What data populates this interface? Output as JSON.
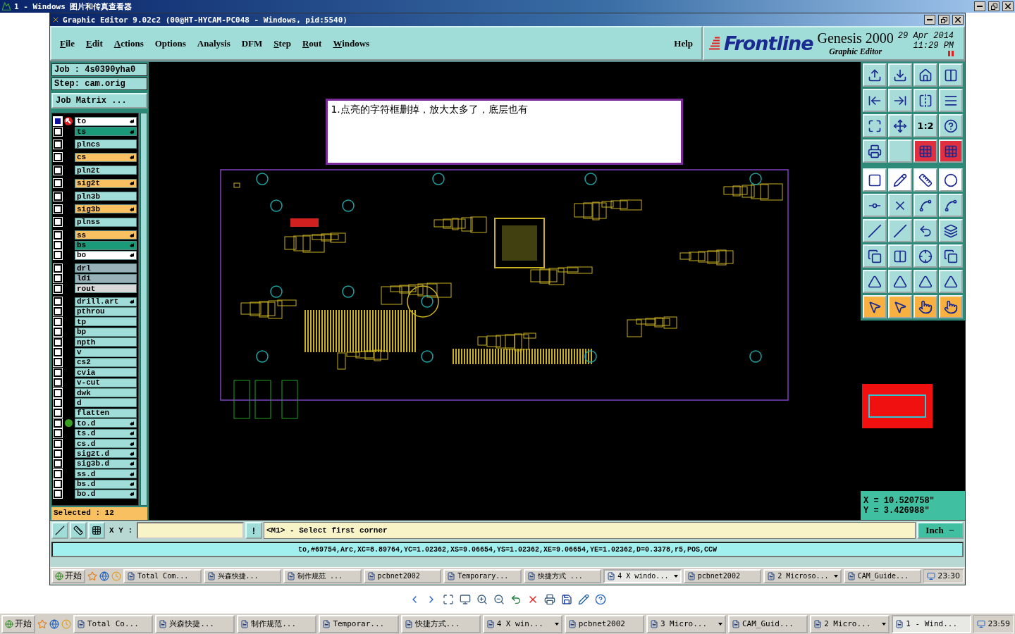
{
  "viewer_window": {
    "title": "1 - Windows 图片和传真查看器"
  },
  "editor_window": {
    "title": "Graphic Editor 9.02c2 (00@HT-HYCAM-PC048 - Windows, pid:5540)"
  },
  "menu": [
    {
      "label": "File",
      "mnemonic": true
    },
    {
      "label": "Edit",
      "mnemonic": true
    },
    {
      "label": "Actions",
      "mnemonic": true
    },
    {
      "label": "Options",
      "mnemonic": false
    },
    {
      "label": "Analysis",
      "mnemonic": false
    },
    {
      "label": "DFM",
      "mnemonic": false
    },
    {
      "label": "Step",
      "mnemonic": true
    },
    {
      "label": "Rout",
      "mnemonic": true
    },
    {
      "label": "Windows",
      "mnemonic": true
    }
  ],
  "help_menu": "Help",
  "brand": {
    "logo": "Frontline",
    "product": "Genesis 2000",
    "subtitle": "Graphic Editor",
    "date": "29 Apr 2014",
    "time": "11:29 PM"
  },
  "job": {
    "job": "Job : 4s0390yha0",
    "step": "Step: cam.orig",
    "matrix_button": "Job Matrix ..."
  },
  "layer_groups": [
    [
      {
        "name": "to",
        "color": "#ffffff",
        "affected": true,
        "work": true,
        "dot": false
      },
      {
        "name": "ts",
        "color": "#1a9a78",
        "affected": true,
        "work": false,
        "dot": false
      }
    ],
    [
      {
        "name": "plncs",
        "color": "#a0dcd8",
        "affected": false,
        "work": false,
        "dot": false
      }
    ],
    [
      {
        "name": "cs",
        "color": "#f8c060",
        "affected": true,
        "work": false,
        "dot": false
      }
    ],
    [
      {
        "name": "pln2t",
        "color": "#a0dcd8",
        "affected": false,
        "work": false,
        "dot": false
      }
    ],
    [
      {
        "name": "sig2t",
        "color": "#f8c060",
        "affected": true,
        "work": false,
        "dot": false
      }
    ],
    [
      {
        "name": "pln3b",
        "color": "#a0dcd8",
        "affected": false,
        "work": false,
        "dot": false
      }
    ],
    [
      {
        "name": "sig3b",
        "color": "#f8c060",
        "affected": true,
        "work": false,
        "dot": false
      }
    ],
    [
      {
        "name": "plnss",
        "color": "#a0dcd8",
        "affected": false,
        "work": false,
        "dot": false
      }
    ],
    [
      {
        "name": "ss",
        "color": "#f8c060",
        "affected": true,
        "work": false,
        "dot": false
      },
      {
        "name": "bs",
        "color": "#1a9a78",
        "affected": true,
        "work": false,
        "dot": false
      },
      {
        "name": "bo",
        "color": "#ffffff",
        "affected": true,
        "work": false,
        "dot": false
      }
    ],
    [
      {
        "name": "drl",
        "color": "#98b0b8",
        "affected": false,
        "work": false,
        "dot": false
      },
      {
        "name": "ldi",
        "color": "#98b0b8",
        "affected": false,
        "work": false,
        "dot": false
      },
      {
        "name": "rout",
        "color": "#d8d8d8",
        "affected": false,
        "work": false,
        "dot": false
      }
    ],
    [
      {
        "name": "drill.art",
        "color": "#a0dcd8",
        "affected": true,
        "work": false,
        "dot": false
      },
      {
        "name": "pthrou",
        "color": "#a0dcd8",
        "affected": false,
        "work": false,
        "dot": false
      },
      {
        "name": "tp",
        "color": "#a0dcd8",
        "affected": false,
        "work": false,
        "dot": false
      },
      {
        "name": "bp",
        "color": "#a0dcd8",
        "affected": false,
        "work": false,
        "dot": false
      },
      {
        "name": "npth",
        "color": "#a0dcd8",
        "affected": false,
        "work": false,
        "dot": false
      },
      {
        "name": "v",
        "color": "#a0dcd8",
        "affected": false,
        "work": false,
        "dot": false
      },
      {
        "name": "cs2",
        "color": "#a0dcd8",
        "affected": false,
        "work": false,
        "dot": false
      },
      {
        "name": "cvia",
        "color": "#a0dcd8",
        "affected": false,
        "work": false,
        "dot": false
      },
      {
        "name": "v-cut",
        "color": "#a0dcd8",
        "affected": false,
        "work": false,
        "dot": false
      },
      {
        "name": "dwk",
        "color": "#a0dcd8",
        "affected": false,
        "work": false,
        "dot": false
      },
      {
        "name": "d",
        "color": "#a0dcd8",
        "affected": false,
        "work": false,
        "dot": false
      },
      {
        "name": "flatten",
        "color": "#a0dcd8",
        "affected": false,
        "work": false,
        "dot": false
      },
      {
        "name": "to.d",
        "color": "#a0dcd8",
        "affected": true,
        "work": false,
        "dot": true
      },
      {
        "name": "ts.d",
        "color": "#a0dcd8",
        "affected": true,
        "work": false,
        "dot": false
      },
      {
        "name": "cs.d",
        "color": "#a0dcd8",
        "affected": true,
        "work": false,
        "dot": false
      },
      {
        "name": "sig2t.d",
        "color": "#a0dcd8",
        "affected": true,
        "work": false,
        "dot": false
      },
      {
        "name": "sig3b.d",
        "color": "#a0dcd8",
        "affected": true,
        "work": false,
        "dot": false
      },
      {
        "name": "ss.d",
        "color": "#a0dcd8",
        "affected": true,
        "work": false,
        "dot": false
      },
      {
        "name": "bs.d",
        "color": "#a0dcd8",
        "affected": true,
        "work": false,
        "dot": false
      },
      {
        "name": "bo.d",
        "color": "#a0dcd8",
        "affected": true,
        "work": false,
        "dot": false
      }
    ]
  ],
  "selected_count": "Selected : 12",
  "note": "1.点亮的字符框删掉，放大太多了，底层也有",
  "tools": [
    {
      "kind": "icon",
      "color": "#a8dcd8"
    },
    {
      "kind": "icon",
      "color": "#a8dcd8"
    },
    {
      "kind": "icon",
      "color": "#a8dcd8"
    },
    {
      "kind": "icon",
      "color": "#a8dcd8"
    },
    {
      "kind": "icon",
      "color": "#a8dcd8"
    },
    {
      "kind": "icon",
      "color": "#a8dcd8"
    },
    {
      "kind": "icon",
      "color": "#a8dcd8"
    },
    {
      "kind": "icon",
      "color": "#a8dcd8"
    },
    {
      "kind": "icon",
      "color": "#a8dcd8"
    },
    {
      "kind": "icon",
      "color": "#a8dcd8"
    },
    {
      "kind": "text",
      "color": "#a8dcd8",
      "label": "1:2"
    },
    {
      "kind": "icon",
      "color": "#a8dcd8"
    },
    {
      "kind": "icon",
      "color": "#a8dcd8"
    },
    {
      "kind": "blank",
      "color": "#a8dcd8"
    },
    {
      "kind": "icon",
      "color": "#e03040"
    },
    {
      "kind": "icon",
      "color": "#e03040"
    },
    {
      "kind": "icon",
      "color": "#ffffff"
    },
    {
      "kind": "icon",
      "color": "#ffffff"
    },
    {
      "kind": "icon",
      "color": "#ffffff"
    },
    {
      "kind": "icon",
      "color": "#ffffff"
    },
    {
      "kind": "icon",
      "color": "#a8dcd8"
    },
    {
      "kind": "icon",
      "color": "#a8dcd8"
    },
    {
      "kind": "icon",
      "color": "#a8dcd8"
    },
    {
      "kind": "icon",
      "color": "#a8dcd8"
    },
    {
      "kind": "icon",
      "color": "#a8dcd8"
    },
    {
      "kind": "icon",
      "color": "#a8dcd8"
    },
    {
      "kind": "icon",
      "color": "#a8dcd8"
    },
    {
      "kind": "icon",
      "color": "#a8dcd8"
    },
    {
      "kind": "icon",
      "color": "#a8dcd8"
    },
    {
      "kind": "icon",
      "color": "#a8dcd8"
    },
    {
      "kind": "icon",
      "color": "#a8dcd8"
    },
    {
      "kind": "icon",
      "color": "#a8dcd8"
    },
    {
      "kind": "icon",
      "color": "#a8dcd8"
    },
    {
      "kind": "icon",
      "color": "#a8dcd8"
    },
    {
      "kind": "icon",
      "color": "#a8dcd8"
    },
    {
      "kind": "icon",
      "color": "#a8dcd8"
    },
    {
      "kind": "icon",
      "color": "#f8b040"
    },
    {
      "kind": "icon",
      "color": "#f8b040"
    },
    {
      "kind": "icon",
      "color": "#f8b040"
    },
    {
      "kind": "icon",
      "color": "#f8b040"
    }
  ],
  "coordinates": {
    "x": "X = 10.520758\"",
    "y": "Y = 3.426988\""
  },
  "command": {
    "xy_label": "X Y :",
    "bang": "!",
    "prompt": "<M1> - Select first corner",
    "units": "Inch"
  },
  "status": "to,#69754,Arc,XC=8.89764,YC=1.02362,XS=9.06654,YS=1.02362,XE=9.06654,YE=1.02362,D=0.3378,r5,POS,CCW",
  "inner_taskbar": {
    "start": "开始",
    "items": [
      {
        "label": "Total Com...",
        "selected": false,
        "grouped": false
      },
      {
        "label": "兴森快捷...",
        "selected": false,
        "grouped": false
      },
      {
        "label": "制作规范 ...",
        "selected": false,
        "grouped": false
      },
      {
        "label": "pcbnet2002",
        "selected": false,
        "grouped": false
      },
      {
        "label": "Temporary...",
        "selected": false,
        "grouped": false
      },
      {
        "label": "快捷方式 ...",
        "selected": false,
        "grouped": false
      },
      {
        "label": "4 X windo...",
        "selected": true,
        "grouped": true
      },
      {
        "label": "pcbnet2002",
        "selected": false,
        "grouped": false
      },
      {
        "label": "2 Microso...",
        "selected": false,
        "grouped": true
      },
      {
        "label": "CAM_Guide...",
        "selected": false,
        "grouped": false
      }
    ],
    "clock": "23:30"
  },
  "outer_taskbar": {
    "start": "开始",
    "items": [
      {
        "label": "Total Co...",
        "selected": false,
        "grouped": false
      },
      {
        "label": "兴森快捷...",
        "selected": false,
        "grouped": false
      },
      {
        "label": "制作规范...",
        "selected": false,
        "grouped": false
      },
      {
        "label": "Temporar...",
        "selected": false,
        "grouped": false
      },
      {
        "label": "快捷方式...",
        "selected": false,
        "grouped": false
      },
      {
        "label": "4 X win...",
        "selected": false,
        "grouped": true
      },
      {
        "label": "pcbnet2002",
        "selected": false,
        "grouped": false
      },
      {
        "label": "3 Micro...",
        "selected": false,
        "grouped": true
      },
      {
        "label": "CAM_Guid...",
        "selected": false,
        "grouped": false
      },
      {
        "label": "2 Micro...",
        "selected": false,
        "grouped": true
      },
      {
        "label": "1 - Wind...",
        "selected": true,
        "grouped": false
      }
    ],
    "clock": "23:59"
  }
}
